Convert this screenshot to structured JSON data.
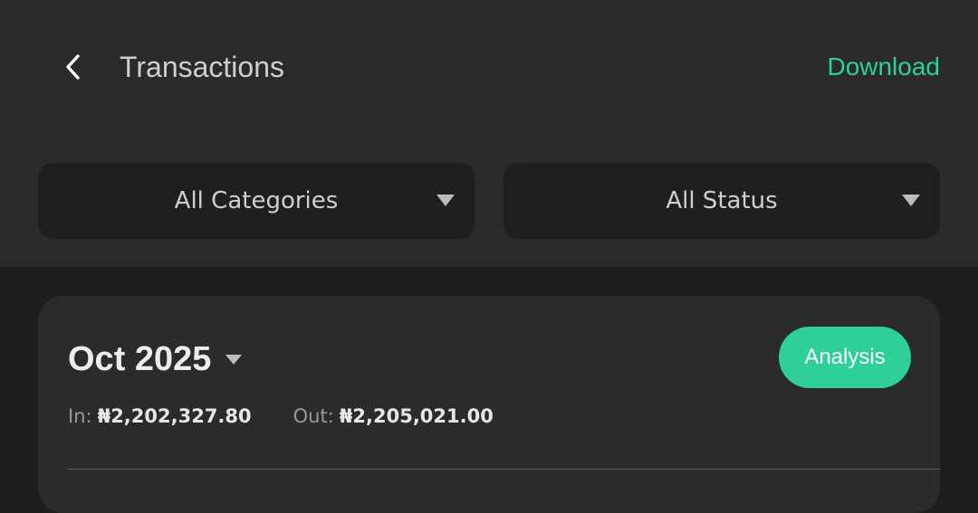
{
  "header": {
    "title": "Transactions",
    "download_label": "Download",
    "back_icon": "chevron-left-icon"
  },
  "filters": {
    "category": {
      "label": "All Categories",
      "icon": "caret-down-icon"
    },
    "status": {
      "label": "All Status",
      "icon": "caret-down-icon"
    }
  },
  "summary": {
    "month": "Oct 2025",
    "analysis_label": "Analysis",
    "in_label": "In:",
    "in_value": "₦2,202,327.80",
    "out_label": "Out:",
    "out_value": "₦2,205,021.00"
  },
  "colors": {
    "accent": "#2ecf9a",
    "background": "#1e1e1e",
    "surface": "#2b2b2b"
  }
}
